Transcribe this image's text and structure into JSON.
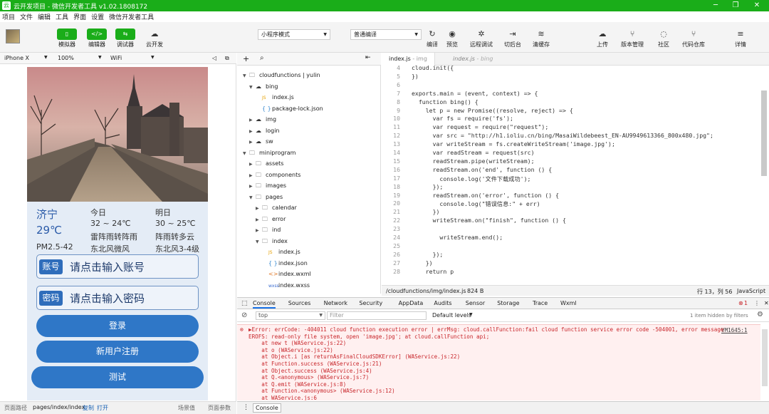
{
  "window": {
    "title": "云开发项目 - 微信开发者工具 v1.02.1808172",
    "logo": "云",
    "controls": [
      "─",
      "❐",
      "✕"
    ]
  },
  "menu": [
    "项目",
    "文件",
    "编辑",
    "工具",
    "界面",
    "设置",
    "微信开发者工具"
  ],
  "toolbar": {
    "buttons": [
      {
        "label": "模拟器",
        "icon": "▯"
      },
      {
        "label": "编辑器",
        "icon": "</>"
      },
      {
        "label": "调试器",
        "icon": "⇆"
      },
      {
        "label": "云开发",
        "icon": "☁"
      }
    ],
    "mode_select": "小程序模式",
    "compile_select": "普通编译",
    "right_buttons": [
      {
        "label": "编译",
        "icon": "↻"
      },
      {
        "label": "预览",
        "icon": "◉"
      },
      {
        "label": "远程调试",
        "icon": "✲"
      },
      {
        "label": "切后台",
        "icon": "⇥"
      },
      {
        "label": "清缓存",
        "icon": "≋"
      },
      {
        "label": "上传",
        "icon": "☁"
      },
      {
        "label": "版本管理",
        "icon": "⑂"
      },
      {
        "label": "社区",
        "icon": "◌"
      },
      {
        "label": "代码仓库",
        "icon": "⑂"
      },
      {
        "label": "详情",
        "icon": "≡"
      }
    ]
  },
  "device_bar": {
    "device": "iPhone X",
    "zoom": "100%",
    "network": "WiFi"
  },
  "app": {
    "weather": {
      "city": "济宁",
      "today_label": "今日",
      "tomorrow_label": "明日",
      "temp": "29℃",
      "today_range": "32 ~ 24℃",
      "tomorrow_range": "30 ~ 25℃",
      "today_desc": "雷阵雨转阵雨",
      "tomorrow_desc": "阵雨转多云",
      "pm": "PM2.5-42",
      "today_wind": "东北风微风",
      "tomorrow_wind": "东北风3-4级"
    },
    "account": {
      "tag": "账号",
      "placeholder": "请点击输入账号"
    },
    "password": {
      "tag": "密码",
      "placeholder": "请点击输入密码"
    },
    "buttons": {
      "login": "登录",
      "register": "新用户注册",
      "test": "测试"
    }
  },
  "statusbar": {
    "path_label": "页面路径",
    "path": "pages/index/index",
    "copy": "复制",
    "open": "打开",
    "scene": "场景值",
    "params": "页面参数"
  },
  "tree": [
    {
      "name": "cloudfunctions | yulin",
      "depth": 0,
      "type": "folder",
      "open": true
    },
    {
      "name": "bing",
      "depth": 1,
      "type": "cloud",
      "open": true
    },
    {
      "name": "index.js",
      "depth": 2,
      "type": "js"
    },
    {
      "name": "package-lock.json",
      "depth": 2,
      "type": "json"
    },
    {
      "name": "img",
      "depth": 1,
      "type": "cloud",
      "open": false
    },
    {
      "name": "login",
      "depth": 1,
      "type": "cloud",
      "open": false
    },
    {
      "name": "sw",
      "depth": 1,
      "type": "cloud",
      "open": false
    },
    {
      "name": "miniprogram",
      "depth": 0,
      "type": "folder",
      "open": true
    },
    {
      "name": "assets",
      "depth": 1,
      "type": "folder",
      "open": false
    },
    {
      "name": "components",
      "depth": 1,
      "type": "folder",
      "open": false
    },
    {
      "name": "images",
      "depth": 1,
      "type": "folder",
      "open": false
    },
    {
      "name": "pages",
      "depth": 1,
      "type": "folder",
      "open": true
    },
    {
      "name": "calendar",
      "depth": 2,
      "type": "folder",
      "open": false
    },
    {
      "name": "error",
      "depth": 2,
      "type": "folder",
      "open": false
    },
    {
      "name": "ind",
      "depth": 2,
      "type": "folder",
      "open": false
    },
    {
      "name": "index",
      "depth": 2,
      "type": "folder",
      "open": true
    },
    {
      "name": "index.js",
      "depth": 3,
      "type": "js"
    },
    {
      "name": "index.json",
      "depth": 3,
      "type": "json"
    },
    {
      "name": "index.wxml",
      "depth": 3,
      "type": "wxml"
    },
    {
      "name": "index.wxss",
      "depth": 3,
      "type": "wxss"
    }
  ],
  "editor": {
    "tabs": [
      {
        "label": "index.js",
        "sub": "- img"
      },
      {
        "label": "index.js",
        "sub": "- bing"
      }
    ],
    "lines": [
      {
        "n": "4",
        "t": "cloud.init({"
      },
      {
        "n": "5",
        "t": "})"
      },
      {
        "n": "6",
        "t": ""
      },
      {
        "n": "7",
        "t": "exports.main = (event, context) => {"
      },
      {
        "n": "8",
        "t": "  function bing() {"
      },
      {
        "n": "9",
        "t": "    let p = new Promise((resolve, reject) => {"
      },
      {
        "n": "10",
        "t": "      var fs = require('fs');"
      },
      {
        "n": "11",
        "t": "      var request = require(\"request\");"
      },
      {
        "n": "12",
        "t": "      var src = \"http://h1.ioliu.cn/bing/MasaiWildebeest_EN-AU9949613366_800x480.jpg\";"
      },
      {
        "n": "13",
        "t": "      var writeStream = fs.createWriteStream('image.jpg');"
      },
      {
        "n": "14",
        "t": "      var readStream = request(src)"
      },
      {
        "n": "15",
        "t": "      readStream.pipe(writeStream);"
      },
      {
        "n": "16",
        "t": "      readStream.on('end', function () {"
      },
      {
        "n": "17",
        "t": "        console.log('文件下载成功');"
      },
      {
        "n": "18",
        "t": "      });"
      },
      {
        "n": "19",
        "t": "      readStream.on('error', function () {"
      },
      {
        "n": "20",
        "t": "        console.log(\"错误信息:\" + err)"
      },
      {
        "n": "21",
        "t": "      })"
      },
      {
        "n": "22",
        "t": "      writeStream.on(\"finish\", function () {"
      },
      {
        "n": "23",
        "t": ""
      },
      {
        "n": "24",
        "t": "        writeStream.end();"
      },
      {
        "n": "25",
        "t": ""
      },
      {
        "n": "26",
        "t": "      });"
      },
      {
        "n": "27",
        "t": "    })"
      },
      {
        "n": "28",
        "t": "    return p"
      }
    ],
    "footer": {
      "path": "/cloudfunctions/img/index.js",
      "size": "824 B",
      "cursor": "行 13，列 56",
      "lang": "JavaScript"
    }
  },
  "devtools": {
    "tabs": [
      "Console",
      "Sources",
      "Network",
      "Security",
      "AppData",
      "Audits",
      "Sensor",
      "Storage",
      "Trace",
      "Wxml"
    ],
    "error_count": "1",
    "context": "top",
    "filter_placeholder": "Filter",
    "levels": "Default levels",
    "hidden": "1 item hidden by filters",
    "error_lines": [
      "▶Error: errCode: -404011 cloud function execution error | errMsg: cloud.callFunction:fail cloud function service error code -504001, error message",
      "EROFS: read-only file system, open 'image.jpg'; at cloud.callFunction api;",
      "    at new t (WAService.js:22)",
      "    at o (WAService.js:22)",
      "    at Object.i [as returnAsFinalCloudSDKError] (WAService.js:22)",
      "    at Function.success (WAService.js:21)",
      "    at Object.success (WAService.js:4)",
      "    at Q.<anonymous> (WAService.js:7)",
      "    at Q.emit (WAService.js:8)",
      "    at Function.<anonymous> (WAService.js:12)",
      "    at WAService.js:6"
    ],
    "error_source": "VM1645:1",
    "drawer_tab": "Console"
  },
  "colors": {
    "accent": "#1aad19",
    "app_blue": "#2f77c7",
    "error": "#c8262b"
  }
}
